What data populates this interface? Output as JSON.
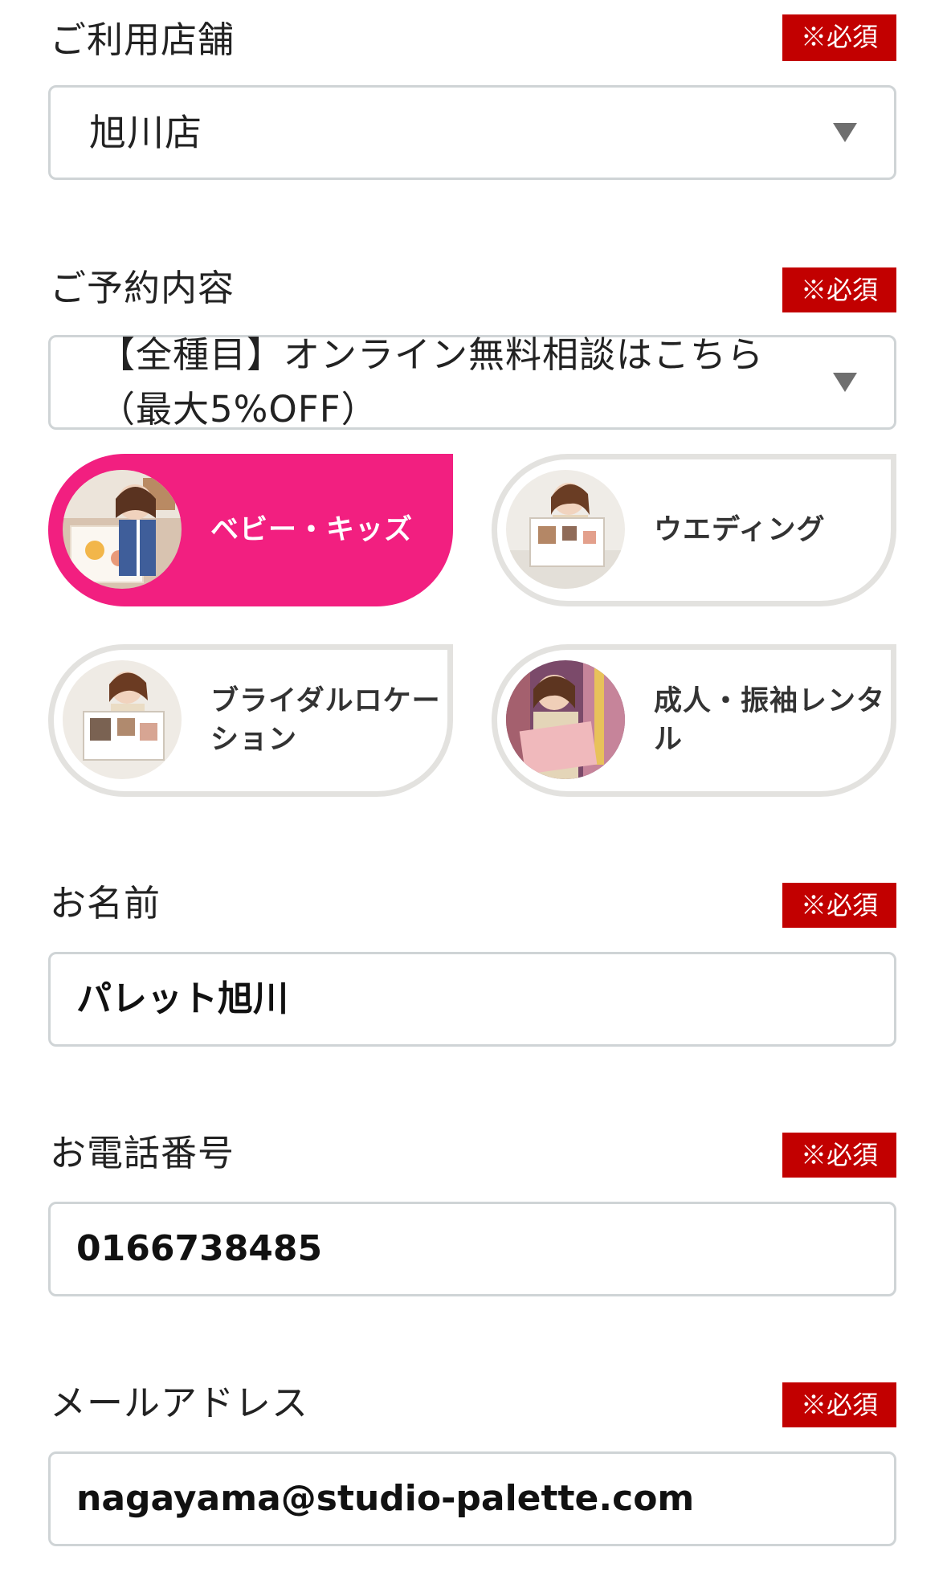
{
  "store": {
    "label": "ご利用店舗",
    "required": "※必須",
    "value": "旭川店"
  },
  "booking": {
    "label": "ご予約内容",
    "required": "※必須",
    "value": "【全種目】オンライン無料相談はこちら（最大5%OFF）"
  },
  "categories": [
    {
      "label": "ベビー・キッズ",
      "selected": true,
      "icon": "staff-photo-baby-kids"
    },
    {
      "label": "ウエディング",
      "selected": false,
      "icon": "staff-photo-wedding"
    },
    {
      "label": "ブライダルロケーション",
      "selected": false,
      "icon": "staff-photo-bridal-location"
    },
    {
      "label": "成人・振袖レンタル",
      "selected": false,
      "icon": "staff-photo-coming-of-age"
    }
  ],
  "name": {
    "label": "お名前",
    "required": "※必須",
    "value": "パレット旭川"
  },
  "phone": {
    "label": "お電話番号",
    "required": "※必須",
    "value": "0166738485"
  },
  "email": {
    "label": "メールアドレス",
    "required": "※必須",
    "value": "nagayama@studio-palette.com"
  },
  "colors": {
    "accent": "#f21f80",
    "required_badge": "#c20000",
    "border": "#cfd4d6",
    "card_border": "#e3e2df"
  }
}
